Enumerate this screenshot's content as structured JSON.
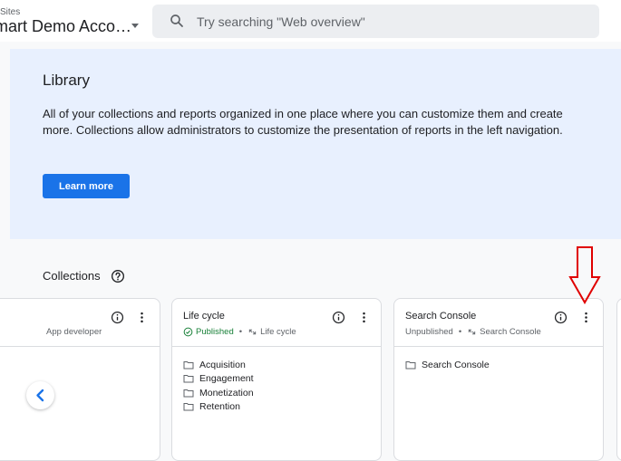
{
  "header": {
    "account_sub": "Sites",
    "account_name": "mart Demo Acco…",
    "search_placeholder": "Try searching \"Web overview\""
  },
  "banner": {
    "title": "Library",
    "description": "All of your collections and reports organized in one place where you can customize them and create more. Collections allow administrators to customize the presentation of reports in the left navigation.",
    "button_label": "Learn more"
  },
  "collections": {
    "title": "Collections",
    "cards": [
      {
        "name": "",
        "status": "",
        "template": "App developer",
        "items": []
      },
      {
        "name": "Life cycle",
        "status": "Published",
        "template": "Life cycle",
        "items": [
          "Acquisition",
          "Engagement",
          "Monetization",
          "Retention"
        ]
      },
      {
        "name": "Search Console",
        "status": "Unpublished",
        "template": "Search Console",
        "items": [
          "Search Console"
        ]
      }
    ],
    "separator": "•"
  },
  "colors": {
    "accent": "#1a73e8",
    "banner_bg": "#e8f0fe",
    "published": "#188038",
    "annotation": "#e00000"
  }
}
